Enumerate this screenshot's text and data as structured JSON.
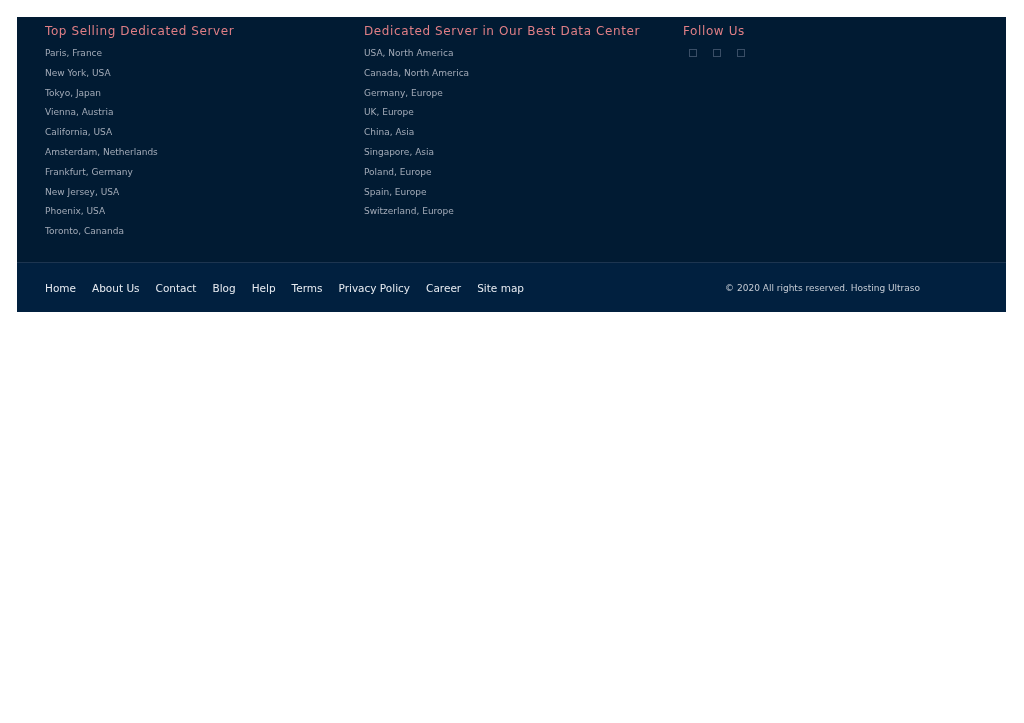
{
  "columns": [
    {
      "heading": "Top Selling Dedicated Server",
      "links": [
        "Paris, France",
        "New York, USA",
        "Tokyo, Japan",
        "Vienna, Austria",
        "California, USA",
        "Amsterdam, Netherlands",
        "Frankfurt, Germany",
        "New Jersey, USA",
        "Phoenix, USA",
        "Toronto, Cananda"
      ]
    },
    {
      "heading": "Dedicated Server in Our Best Data Center",
      "links": [
        "USA, North America",
        "Canada, North America",
        "Germany, Europe",
        "UK, Europe",
        "China, Asia",
        "Singapore, Asia",
        "Poland, Europe",
        "Spain, Europe",
        "Switzerland, Europe"
      ]
    }
  ],
  "follow": {
    "heading": "Follow Us",
    "icons": [
      {
        "kind": "square"
      },
      {
        "kind": "square"
      },
      {
        "kind": "square"
      }
    ]
  },
  "bottom_nav": [
    "Home",
    "About Us",
    "Contact",
    "Blog",
    "Help",
    "Terms",
    "Privacy Policy",
    "Career",
    "Site map"
  ],
  "copyright": "© 2020 All rights reserved. Hosting Ultraso"
}
